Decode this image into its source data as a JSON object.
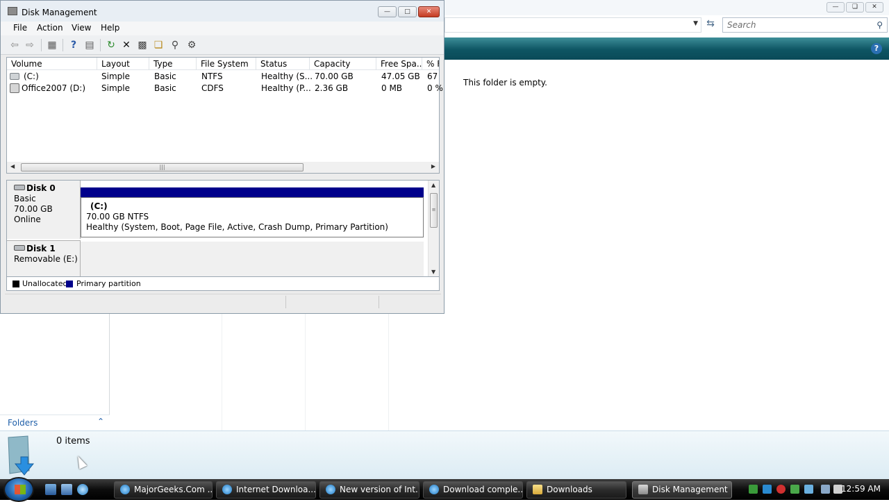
{
  "explorer": {
    "search_placeholder": "Search",
    "empty_message": "This folder is empty.",
    "nav": {
      "folders_label": "Folders"
    },
    "details": {
      "item_count": "0 items"
    },
    "colors": {
      "command_bar": "#0e5563"
    }
  },
  "disk_management": {
    "title": "Disk Management",
    "menu": [
      "File",
      "Action",
      "View",
      "Help"
    ],
    "toolbar_icons": [
      "back-icon",
      "forward-icon",
      "show-hide-tree-icon",
      "help-icon",
      "properties-view-icon",
      "refresh-icon",
      "delete-icon",
      "properties-icon",
      "open-icon",
      "explore-icon",
      "settings-icon"
    ],
    "volume_list": {
      "columns": [
        "Volume",
        "Layout",
        "Type",
        "File System",
        "Status",
        "Capacity",
        "Free Spa...",
        "% F"
      ],
      "rows": [
        {
          "volume": "(C:)",
          "layout": "Simple",
          "type": "Basic",
          "fs": "NTFS",
          "status": "Healthy (S...",
          "capacity": "70.00 GB",
          "free": "47.05 GB",
          "pct": "67"
        },
        {
          "volume": "Office2007 (D:)",
          "layout": "Simple",
          "type": "Basic",
          "fs": "CDFS",
          "status": "Healthy (P...",
          "capacity": "2.36 GB",
          "free": "0 MB",
          "pct": "0 %"
        }
      ]
    },
    "disks": [
      {
        "name": "Disk 0",
        "kind": "Basic",
        "size": "70.00 GB",
        "state": "Online",
        "partition": {
          "label": "(C:)",
          "size_fs": "70.00 GB NTFS",
          "status": "Healthy (System, Boot, Page File, Active, Crash Dump, Primary Partition)"
        }
      },
      {
        "name": "Disk 1",
        "kind": "Removable (E:)"
      }
    ],
    "legend": [
      {
        "label": "Unallocated",
        "color": "#000000"
      },
      {
        "label": "Primary partition",
        "color": "#00008b"
      }
    ]
  },
  "taskbar": {
    "tasks": [
      {
        "label": "MajorGeeks.Com ..."
      },
      {
        "label": "Internet Downloa..."
      },
      {
        "label": "New version of Int..."
      },
      {
        "label": "Download comple..."
      },
      {
        "label": "Downloads"
      },
      {
        "label": "Disk Management"
      }
    ],
    "clock": "12:59 AM"
  }
}
